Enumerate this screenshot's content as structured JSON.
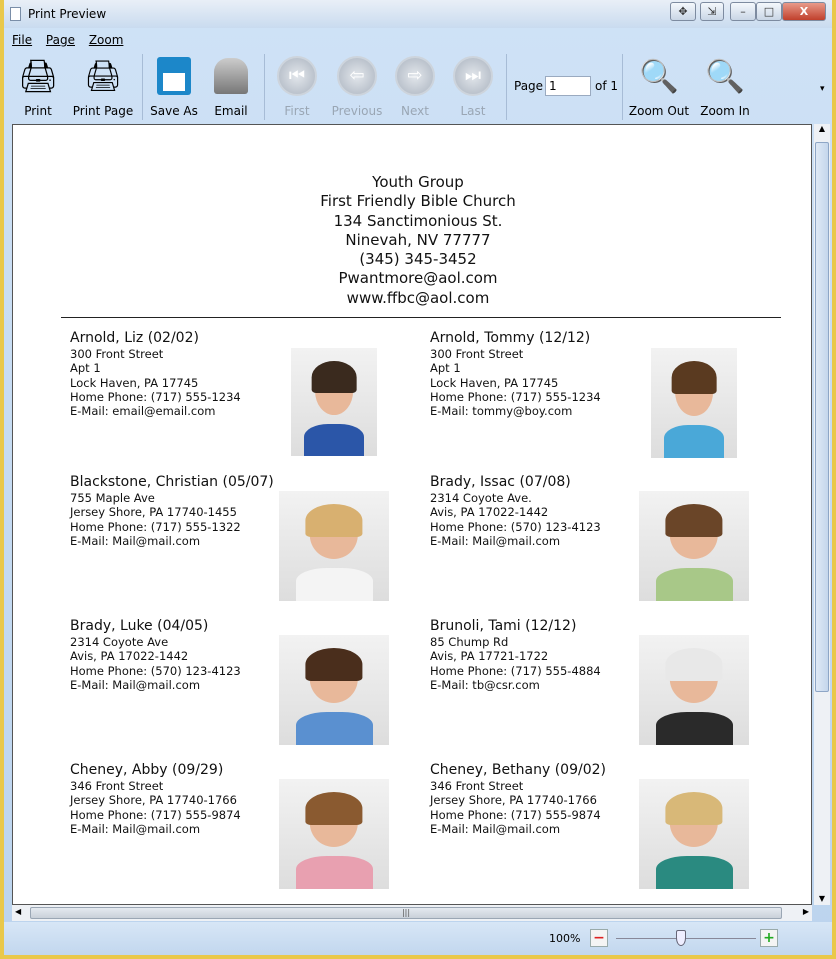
{
  "window": {
    "title": "Print Preview"
  },
  "menu": [
    "File",
    "Page",
    "Zoom"
  ],
  "toolbar": {
    "print": "Print",
    "print_page": "Print Page",
    "save_as": "Save As",
    "email": "Email",
    "first": "First",
    "previous": "Previous",
    "next": "Next",
    "last": "Last",
    "page_label": "Page",
    "page_value": "1",
    "page_of": "of 1",
    "zoom_out": "Zoom Out",
    "zoom_in": "Zoom In"
  },
  "header": [
    "Youth Group",
    "First Friendly Bible Church",
    "134 Sanctimonious St.",
    "Ninevah, NV 77777",
    "(345) 345-3452",
    "Pwantmore@aol.com",
    "www.ffbc@aol.com"
  ],
  "entries": [
    {
      "name": "Arnold, Liz (02/02)",
      "lines": [
        "300 Front Street",
        "Apt 1",
        "Lock Haven, PA  17745",
        "Home Phone: (717) 555-1234",
        "E-Mail: email@email.com"
      ]
    },
    {
      "name": "Arnold, Tommy (12/12)",
      "lines": [
        "300 Front Street",
        "Apt 1",
        "Lock Haven, PA  17745",
        "Home Phone: (717) 555-1234",
        "E-Mail: tommy@boy.com"
      ]
    },
    {
      "name": "Blackstone, Christian (05/07)",
      "lines": [
        "755 Maple Ave",
        "Jersey Shore, PA  17740-1455",
        "Home Phone: (717) 555-1322",
        "E-Mail: Mail@mail.com"
      ]
    },
    {
      "name": "Brady, Issac (07/08)",
      "lines": [
        "2314 Coyote Ave.",
        "Avis, PA  17022-1442",
        "Home Phone: (570) 123-4123",
        "E-Mail: Mail@mail.com"
      ]
    },
    {
      "name": "Brady, Luke (04/05)",
      "lines": [
        "2314 Coyote Ave",
        "Avis, PA  17022-1442",
        "Home Phone: (570) 123-4123",
        "E-Mail: Mail@mail.com"
      ]
    },
    {
      "name": "Brunoli, Tami (12/12)",
      "lines": [
        "85 Chump Rd",
        "Avis, PA  17721-1722",
        "Home Phone: (717) 555-4884",
        "E-Mail: tb@csr.com"
      ]
    },
    {
      "name": "Cheney, Abby (09/29)",
      "lines": [
        "346 Front Street",
        "Jersey Shore, PA  17740-1766",
        "Home Phone: (717) 555-9874",
        "E-Mail: Mail@mail.com"
      ]
    },
    {
      "name": "Cheney, Bethany (09/02)",
      "lines": [
        "346 Front Street",
        "Jersey Shore, PA  17740-1766",
        "Home Phone: (717) 555-9874",
        "E-Mail: Mail@mail.com"
      ]
    }
  ],
  "status": {
    "zoom": "100%"
  }
}
